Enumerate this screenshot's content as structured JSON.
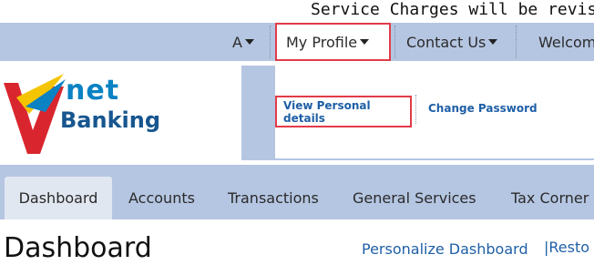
{
  "ticker": {
    "text": "Service Charges will be revised v"
  },
  "topnav": {
    "font_size_label": "A",
    "my_profile_label": "My Profile",
    "contact_us_label": "Contact Us",
    "welcome_label": "Welcom"
  },
  "logo": {
    "v": "V",
    "net": "net",
    "banking": "Banking"
  },
  "profile_menu": {
    "view_personal_label": "View Personal details",
    "change_password_label": "Change Password"
  },
  "mainnav": {
    "tabs": [
      "Dashboard",
      "Accounts",
      "Transactions",
      "General Services",
      "Tax Corner"
    ]
  },
  "page": {
    "title": "Dashboard",
    "personalize_label": "Personalize Dashboard",
    "restore_label": "|Resto"
  },
  "colors": {
    "nav_bg": "#b5c6e2",
    "link": "#1f5fa6",
    "highlight_border": "#e23b48",
    "logo_blue": "#0a82c3",
    "logo_red": "#d9262e",
    "logo_yellow": "#f5c400"
  }
}
